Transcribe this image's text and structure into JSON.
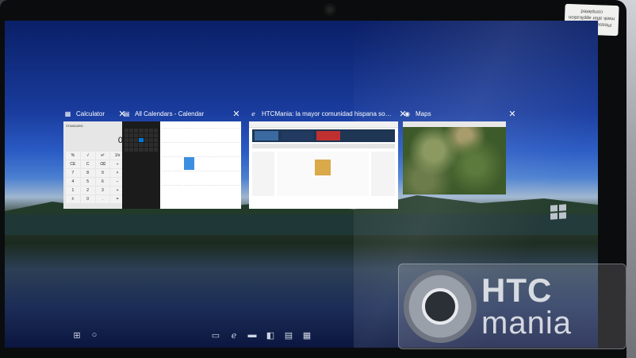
{
  "task_view": {
    "windows": [
      {
        "title": "Calculator",
        "icon": "calculator-icon",
        "close": "✕",
        "preview": {
          "mode": "STANDARD",
          "display": "0",
          "keys": [
            "%",
            "√",
            "x²",
            "1/x",
            "CE",
            "C",
            "⌫",
            "÷",
            "7",
            "8",
            "9",
            "×",
            "4",
            "5",
            "6",
            "−",
            "1",
            "2",
            "3",
            "+",
            "±",
            "0",
            ".",
            "="
          ]
        }
      },
      {
        "title": "All Calendars - Calendar",
        "icon": "calendar-icon",
        "close": "✕"
      },
      {
        "title": "HTCMania: la mayor comunidad hispana sobre smartphon...",
        "icon": "edge-icon",
        "close": "✕"
      },
      {
        "title": "Maps",
        "icon": "maps-icon",
        "close": "✕"
      }
    ]
  },
  "taskbar": {
    "start_icon": "windows-icon",
    "cortana_icon": "cortana-icon",
    "apps": [
      "task-view-icon",
      "edge-icon",
      "file-explorer-icon",
      "store-icon",
      "calendar-icon",
      "calculator-icon"
    ]
  },
  "watermark": {
    "line1": "HTC",
    "line2": "mania"
  },
  "sticker": {
    "text": "Please peel off this mask after application completed"
  },
  "colors": {
    "accent": "#0078d7",
    "screen_top": "#0a1f66"
  }
}
